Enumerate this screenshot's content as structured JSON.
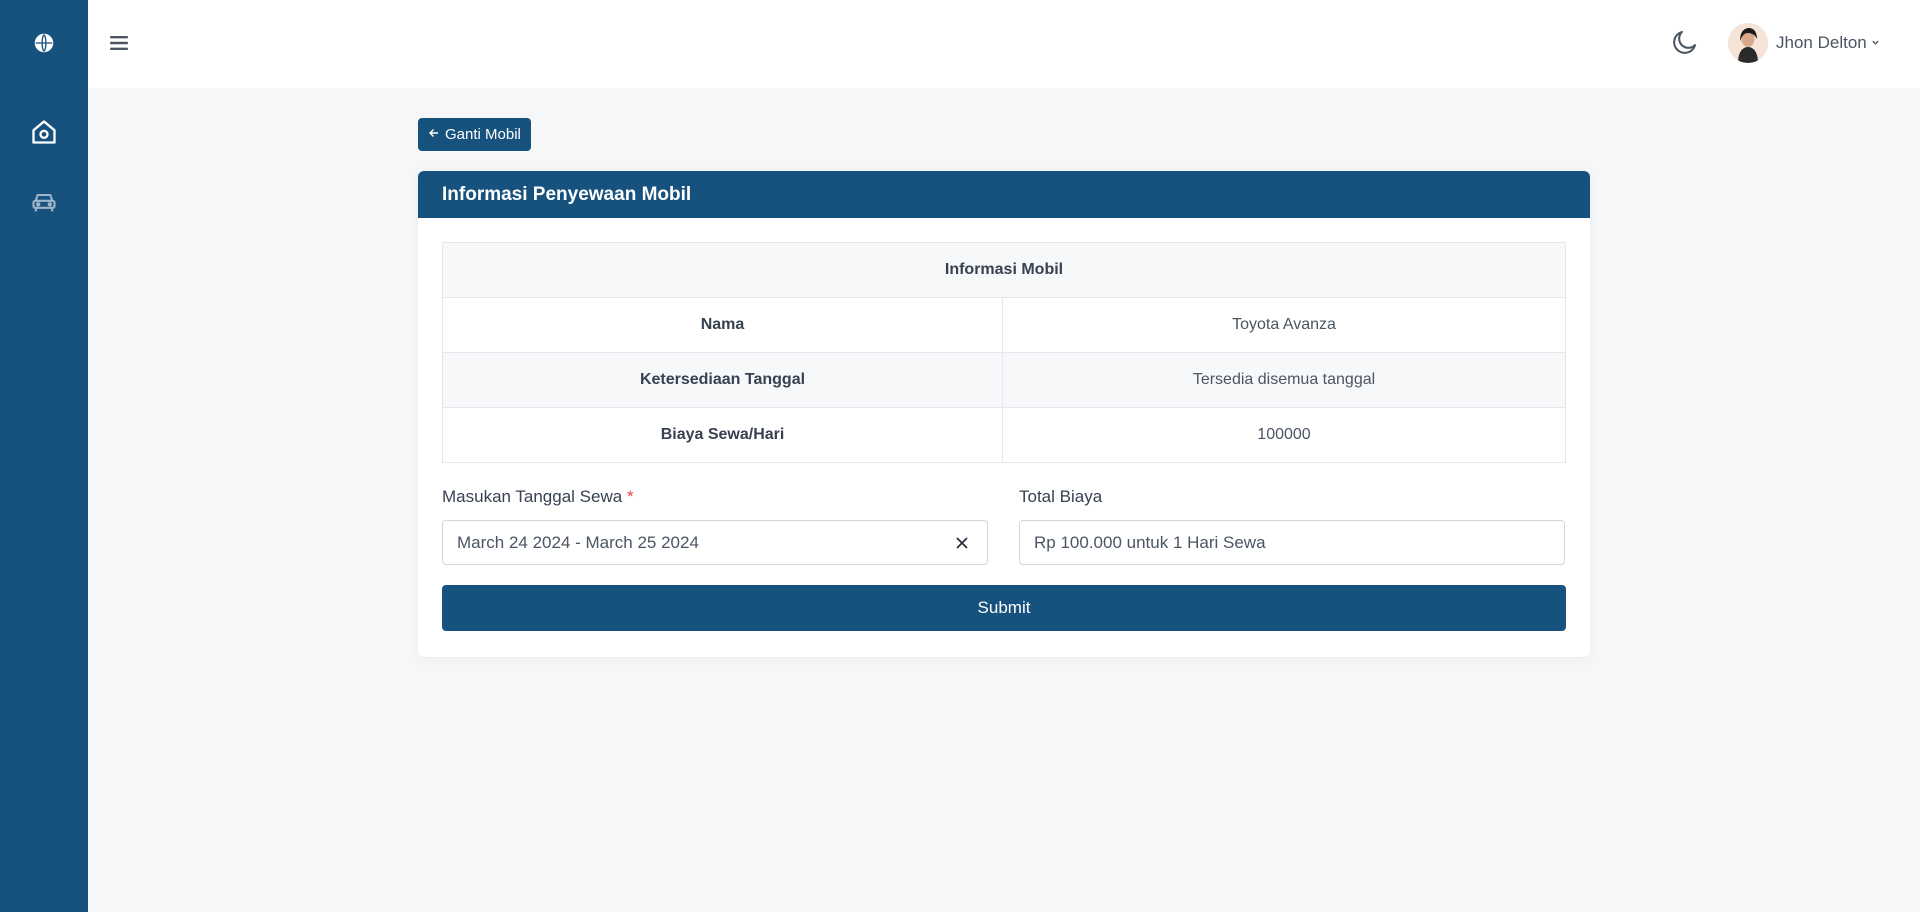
{
  "sidebar": {
    "icons": [
      "globe-icon",
      "home-icon",
      "car-icon"
    ]
  },
  "header": {
    "username": "Jhon Delton"
  },
  "back_button": {
    "label": "Ganti Mobil"
  },
  "card": {
    "title": "Informasi Penyewaan Mobil",
    "table": {
      "heading": "Informasi Mobil",
      "rows": [
        {
          "label": "Nama",
          "value": "Toyota Avanza"
        },
        {
          "label": "Ketersediaan Tanggal",
          "value": "Tersedia disemua tanggal"
        },
        {
          "label": "Biaya Sewa/Hari",
          "value": "100000"
        }
      ]
    },
    "form": {
      "date_label": "Masukan Tanggal Sewa",
      "date_required": "*",
      "date_value": "March 24 2024 - March 25 2024",
      "total_label": "Total Biaya",
      "total_value": "Rp 100.000 untuk 1 Hari Sewa",
      "submit_label": "Submit"
    }
  },
  "colors": {
    "primary": "#17527e",
    "background": "#f6f7f9",
    "required": "#ef4444"
  }
}
